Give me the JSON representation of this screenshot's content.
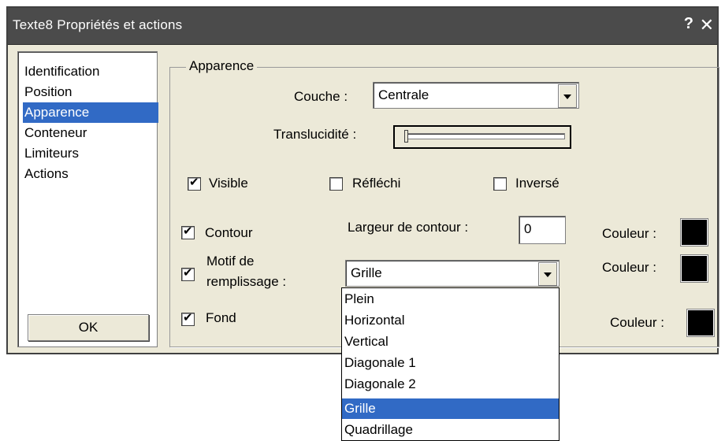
{
  "window": {
    "title": "Texte8 Propriétés et actions",
    "help_label": "?",
    "close_label": "✕"
  },
  "sidebar": {
    "items": [
      {
        "label": "Identification",
        "selected": false
      },
      {
        "label": "Position",
        "selected": false
      },
      {
        "label": "Apparence",
        "selected": true
      },
      {
        "label": "Conteneur",
        "selected": false
      },
      {
        "label": "Limiteurs",
        "selected": false
      },
      {
        "label": "Actions",
        "selected": false
      }
    ],
    "ok_label": "OK"
  },
  "panel": {
    "group_title": "Apparence",
    "layer_label": "Couche :",
    "layer_value": "Centrale",
    "translucency_label": "Translucidité :",
    "translucency_value": 0,
    "visible_label": "Visible",
    "visible_checked": true,
    "reflected_label": "Réfléchi",
    "reflected_checked": false,
    "inverted_label": "Inversé",
    "inverted_checked": false,
    "contour_label": "Contour",
    "contour_checked": true,
    "contour_width_label": "Largeur de contour :",
    "contour_width_value": "0",
    "color_label": "Couleur :",
    "fill_pattern_label_1": "Motif de",
    "fill_pattern_label_2": "remplissage :",
    "fill_pattern_checked": true,
    "fill_pattern_value": "Grille",
    "background_label": "Fond",
    "background_checked": true,
    "colors": {
      "contour": "#000000",
      "fill_pattern": "#000000",
      "background": "#000000"
    }
  },
  "dropdown": {
    "options": [
      "Plein",
      "Horizontal",
      "Vertical",
      "Diagonale 1",
      "Diagonale 2",
      "Grille",
      "Quadrillage"
    ],
    "selected": "Grille"
  },
  "icons": {
    "checkmark": "checkmark-icon",
    "dropdown_arrow": "chevron-down-icon"
  }
}
